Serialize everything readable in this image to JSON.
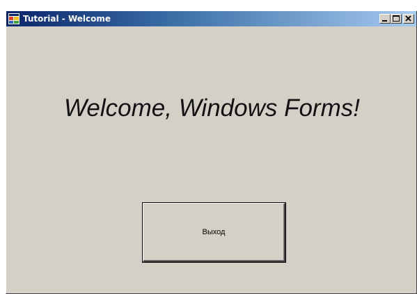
{
  "window": {
    "title": "Tutorial - Welcome",
    "controls": {
      "minimize_icon": "minimize-icon",
      "maximize_icon": "maximize-icon",
      "close_icon": "close-icon"
    }
  },
  "main": {
    "welcome_text": "Welcome, Windows Forms!",
    "exit_button_label": "Выход"
  },
  "colors": {
    "titlebar_start": "#0a246a",
    "titlebar_end": "#a6caf0",
    "face": "#d4d0c8"
  }
}
